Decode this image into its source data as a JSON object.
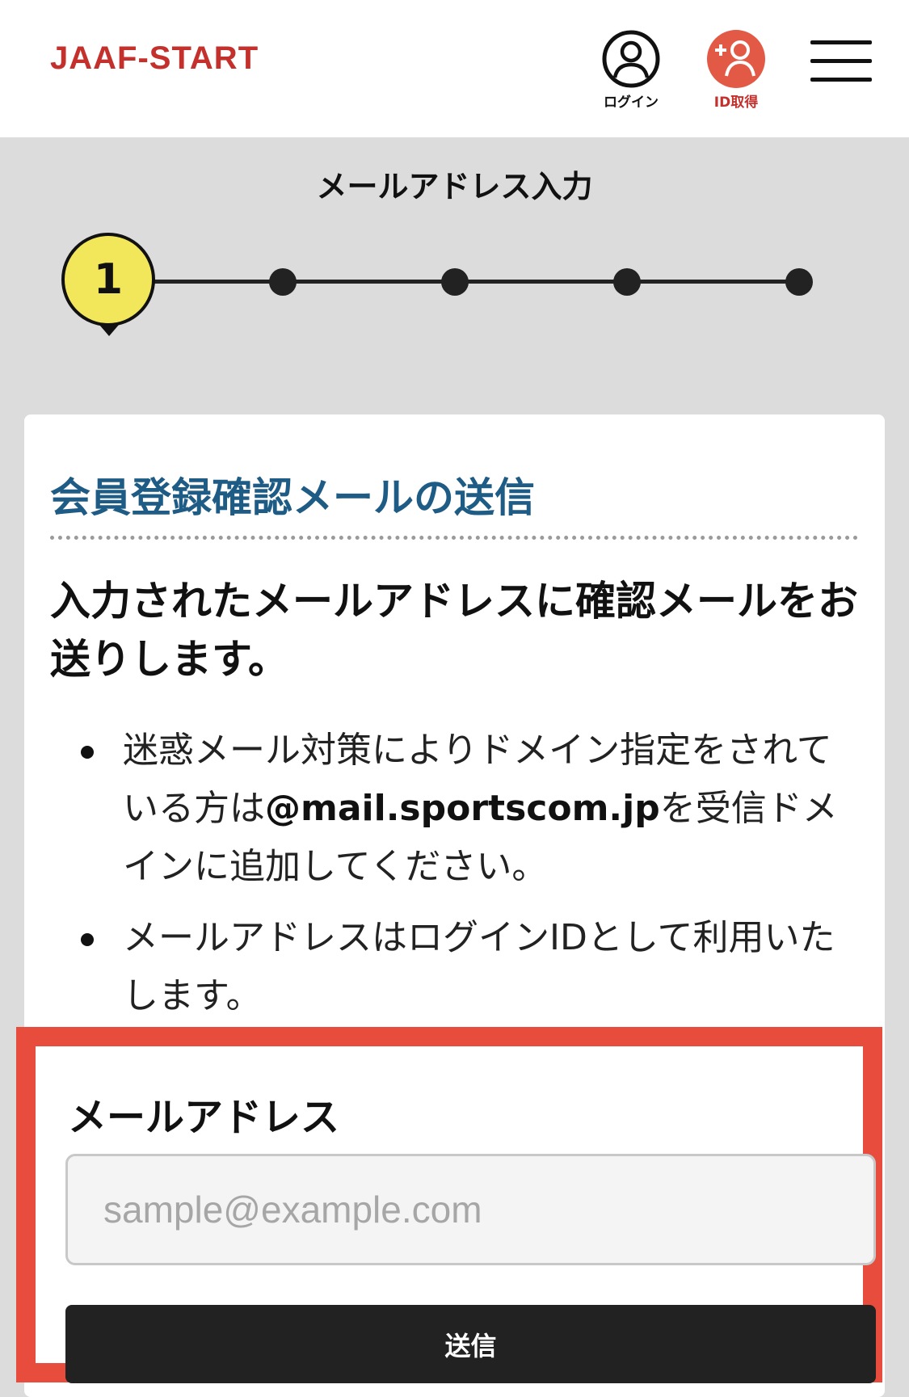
{
  "header": {
    "logo": "JAAF-START",
    "login_label": "ログイン",
    "register_label": "ID取得",
    "accent_color": "#c4312d"
  },
  "steps": {
    "current_title": "メールアドレス入力",
    "current_number": "1",
    "total": 5
  },
  "card": {
    "title": "会員登録確認メールの送信",
    "lead": "入力されたメールアドレスに確認メールをお送りします。",
    "notes": [
      {
        "before": "迷惑メール対策によりドメイン指定をされている方は",
        "domain": "@mail.sportscom.jp",
        "after": "を受信ドメインに追加してください。"
      },
      {
        "text": "メールアドレスはログインIDとして利用いたします。"
      }
    ]
  },
  "form": {
    "email_label": "メールアドレス",
    "email_placeholder": "sample@example.com",
    "email_value": "",
    "submit_label": "送信",
    "highlight_color": "#e74c3c"
  },
  "icons": {
    "login": "user-circle-icon",
    "register": "user-add-icon",
    "menu": "hamburger-menu-icon"
  }
}
